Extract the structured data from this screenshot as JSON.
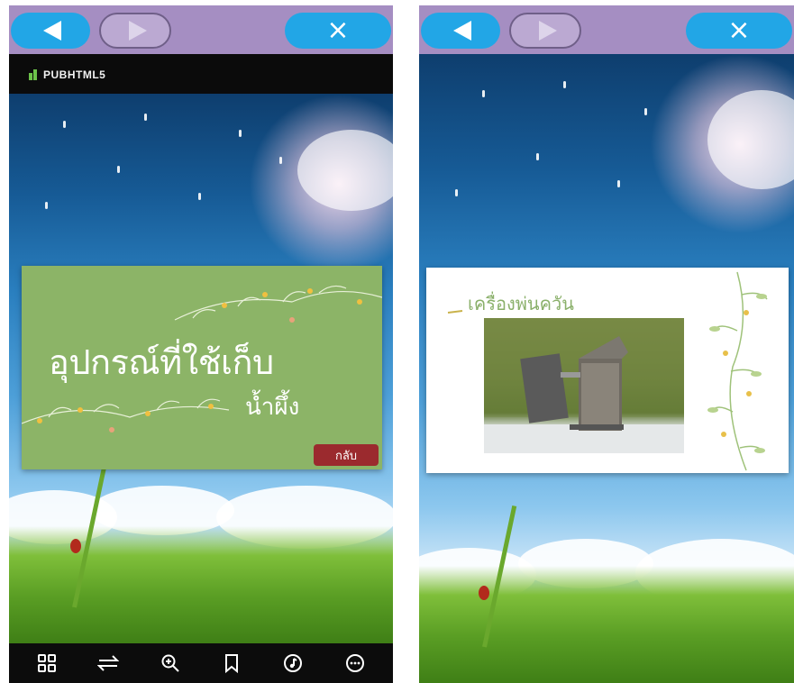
{
  "left_screen": {
    "nav": {
      "prev_icon": "arrow-left-icon",
      "next_icon": "arrow-right-icon",
      "close_label": "×"
    },
    "logo_text": "PUBHTML5",
    "slide": {
      "title": "อุปกรณ์ที่ใช้เก็บ",
      "subtitle": "น้ำผึ้ง",
      "back_label": "กลับ"
    },
    "toolbar": [
      {
        "name": "thumbnails-icon"
      },
      {
        "name": "swap-icon"
      },
      {
        "name": "zoom-in-icon"
      },
      {
        "name": "bookmark-icon"
      },
      {
        "name": "music-icon"
      },
      {
        "name": "more-icon"
      }
    ]
  },
  "right_screen": {
    "nav": {
      "prev_icon": "arrow-left-icon",
      "next_icon": "arrow-right-icon",
      "close_label": "×"
    },
    "slide": {
      "title": "เครื่องพ่นควัน"
    }
  },
  "colors": {
    "topbar": "#a58ec2",
    "nav_button": "#22a6e6",
    "slide_green": "#8cb467",
    "back_button": "#9b2a2e",
    "title_green": "#8ab06a"
  }
}
